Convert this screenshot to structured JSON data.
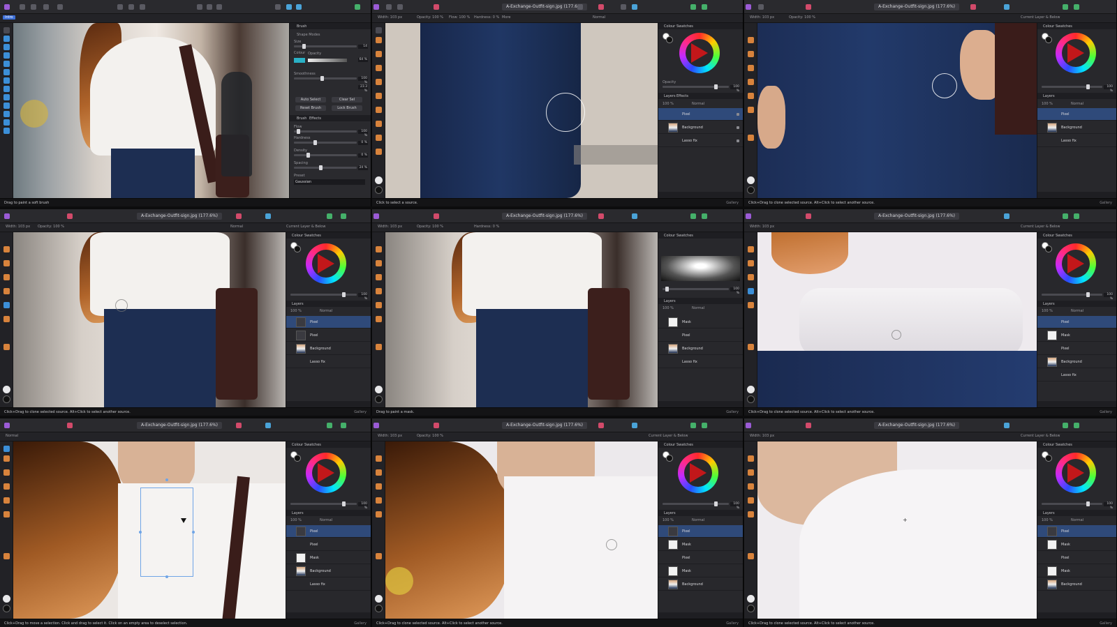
{
  "app": {
    "tab_badge": "Intro",
    "doc_title": "A-Exchange-Outfit-sign.jpg (177.6%)",
    "context": {
      "width": "Width: 103 px",
      "opacity": "Opacity: 100 %",
      "flow": "Flow: 100 %",
      "hardness": "Hardness: 0 %",
      "more": "More",
      "sample": "Current Layer & Below",
      "mode": "Normal"
    }
  },
  "panels": {
    "color_tab": "Colour",
    "swatches_tab": "Swatches",
    "opacity_label": "Opacity",
    "opacity_value": "100 %",
    "layers_tab": "Layers",
    "layers_sub": "Effects",
    "layer_opacity": "100 %",
    "blend_mode": "Normal",
    "layers": {
      "pixel": "Pixel",
      "background": "Background",
      "lasso": "Lasso fix",
      "mask": "Mask",
      "mask2": "Pixel"
    }
  },
  "brush_panel": {
    "title": "Brush",
    "shape_label": "Shape Modes",
    "size_label": "Size",
    "size_value": "14",
    "color_label": "Colour",
    "opacity_label": "Opacity",
    "opacity_value": "64 %",
    "smoothness_label": "Smoothness",
    "smoothness_value": "100 %",
    "smoothness_value2": "23.3 %",
    "btn_auto": "Auto Select",
    "btn_clear": "Clear Sel",
    "btn_reset": "Reset Brush",
    "btn_lock": "Lock Brush",
    "tab_brush": "Brush",
    "tab_effects": "Effects",
    "flow_label": "Flow",
    "flow_value": "100 %",
    "hardness_label": "Hardness",
    "hardness_value": "0 %",
    "density_label": "Density",
    "density_value": "0 %",
    "spacing_label": "Spacing",
    "spacing_value": "24 %",
    "preset_label": "Preset",
    "preset_value": "Gaussian"
  },
  "status": {
    "s0": "Drag to paint a soft brush",
    "s1": "Click to select a source.",
    "s2": "Click+Drag to clone selected source. Alt+Click to select another source.",
    "s3": "Click+Drag to clone selected source. Alt+Click to select another source.",
    "s4": "Drag to paint a mask.",
    "s5": "Click+Drag to clone selected source. Alt+Click to select another source.",
    "s6": "Click+Drag to move a selection. Click and drag to select it. Click on an empty area to deselect selection.",
    "s7": "Click+Drag to clone selected source. Alt+Click to select another source.",
    "s8": "Click+Drag to clone selected source. Alt+Click to select another source.",
    "right": "Gallery"
  },
  "colors": {
    "selection": "#2f4a7a",
    "accent": "#2ab1c6",
    "red": "#c2171a"
  }
}
